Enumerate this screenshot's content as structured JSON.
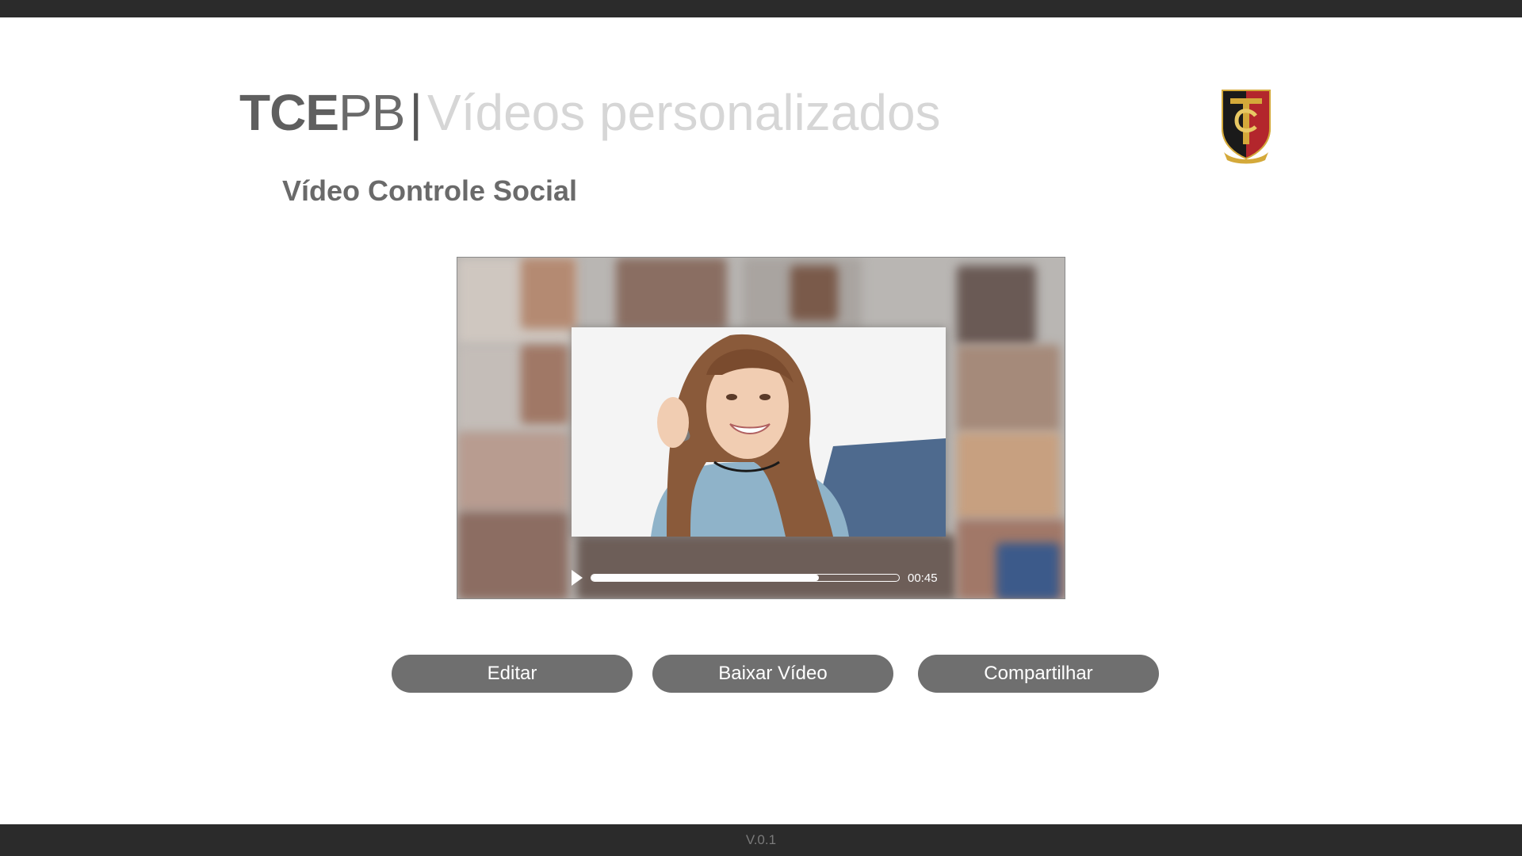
{
  "header": {
    "brand_bold": "TCE",
    "brand_light": "PB",
    "divider": "|",
    "subtitle": "Vídeos personalizados"
  },
  "page": {
    "heading": "Vídeo Controle Social"
  },
  "video": {
    "time": "00:45",
    "progress": 0.74
  },
  "actions": {
    "edit_label": "Editar",
    "download_label": "Baixar Vídeo",
    "share_label": "Compartilhar"
  },
  "footer": {
    "version": "V.0.1"
  },
  "colors": {
    "bar": "#2b2b2b",
    "button": "#6f6f6f",
    "logo_red": "#b3262c",
    "logo_black": "#1a1a1a",
    "logo_gold": "#d4a93a"
  }
}
